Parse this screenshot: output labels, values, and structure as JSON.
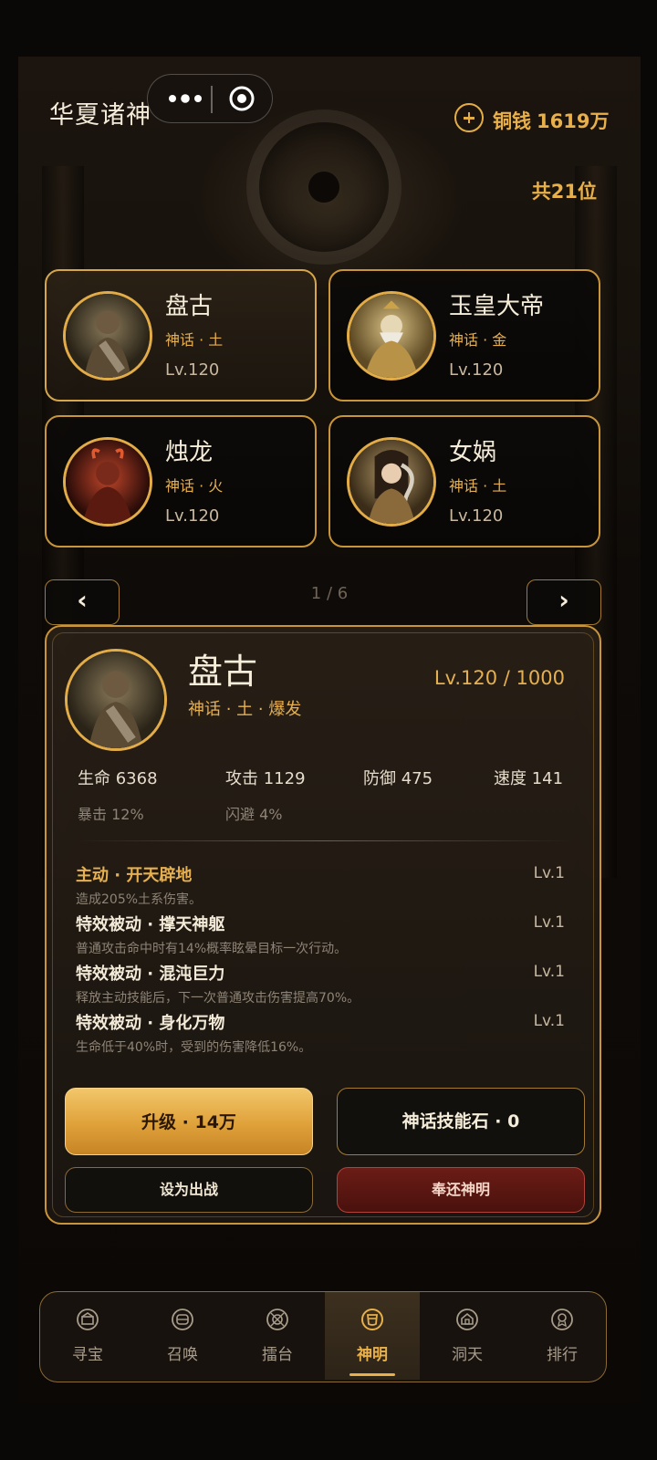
{
  "header": {
    "title": "华夏诸神",
    "coins_label": "铜钱",
    "coins_value": "1619万",
    "god_count": "共21位"
  },
  "gods": [
    {
      "name": "盘古",
      "tags": "神话 · 土",
      "level": "Lv.120",
      "selected": true
    },
    {
      "name": "玉皇大帝",
      "tags": "神话 · 金",
      "level": "Lv.120",
      "selected": false
    },
    {
      "name": "烛龙",
      "tags": "神话 · 火",
      "level": "Lv.120",
      "selected": false
    },
    {
      "name": "女娲",
      "tags": "神话 · 土",
      "level": "Lv.120",
      "selected": false
    }
  ],
  "pager": {
    "prev": "‹",
    "next": "›",
    "indicator": "1 / 6"
  },
  "detail": {
    "name": "盘古",
    "tags": "神话 · 土 · 爆发",
    "level": "Lv.120 / 1000",
    "stats": {
      "hp": "生命 6368",
      "atk": "攻击 1129",
      "def": "防御 475",
      "spd": "速度 141",
      "crit": "暴击 12%",
      "dodge": "闪避 4%"
    },
    "skills": [
      {
        "name": "主动 · 开天辟地",
        "level": "Lv.1",
        "desc": "造成205%土系伤害。",
        "color": "#e6b050"
      },
      {
        "name": "特效被动 · 撑天神躯",
        "level": "Lv.1",
        "desc": "普通攻击命中时有14%概率眩晕目标一次行动。",
        "color": "#f3ead8"
      },
      {
        "name": "特效被动 · 混沌巨力",
        "level": "Lv.1",
        "desc": "释放主动技能后，下一次普通攻击伤害提高70%。",
        "color": "#f3ead8"
      },
      {
        "name": "特效被动 · 身化万物",
        "level": "Lv.1",
        "desc": "生命低于40%时，受到的伤害降低16%。",
        "color": "#f3ead8"
      }
    ],
    "buttons": {
      "upgrade": "升级 · 14万",
      "stone": "神话技能石 · 0",
      "deploy": "设为出战",
      "return": "奉还神明"
    }
  },
  "tabs": [
    {
      "label": "寻宝",
      "icon": "treasure-icon"
    },
    {
      "label": "召唤",
      "icon": "summon-icon"
    },
    {
      "label": "擂台",
      "icon": "arena-icon"
    },
    {
      "label": "神明",
      "icon": "gods-icon",
      "active": true
    },
    {
      "label": "洞天",
      "icon": "cave-icon"
    },
    {
      "label": "排行",
      "icon": "ranking-icon"
    }
  ],
  "colors": {
    "accent": "#e8b04a",
    "border": "#c9953a",
    "danger": "#6b1c16"
  }
}
